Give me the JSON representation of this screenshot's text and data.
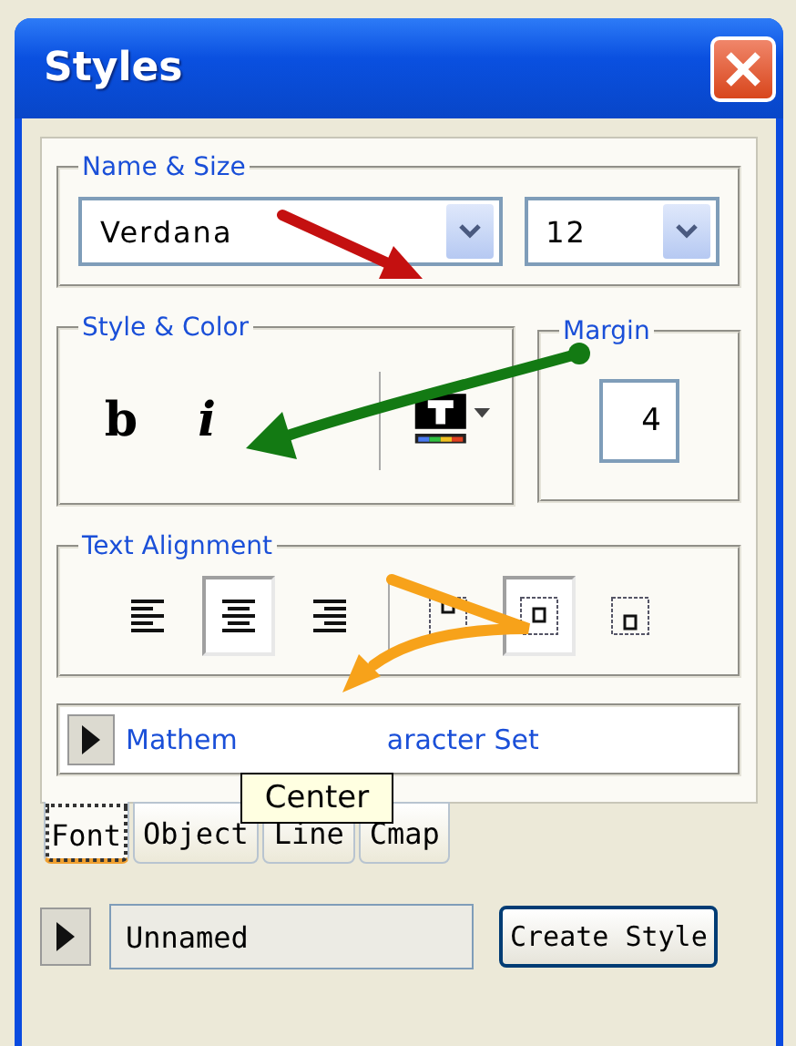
{
  "window": {
    "title": "Styles"
  },
  "name_size": {
    "legend": "Name & Size",
    "font": "Verdana",
    "size": "12"
  },
  "style_color": {
    "legend": "Style & Color",
    "bold": "b",
    "italic": "i"
  },
  "margin": {
    "legend": "Margin",
    "value": "4"
  },
  "text_alignment": {
    "legend": "Text Alignment",
    "buttons": [
      {
        "kind": "left",
        "selected": false
      },
      {
        "kind": "center",
        "selected": true
      },
      {
        "kind": "right",
        "selected": false
      },
      {
        "kind": "top",
        "selected": false
      },
      {
        "kind": "middle",
        "selected": true
      },
      {
        "kind": "bottom",
        "selected": false
      }
    ]
  },
  "character_set": {
    "text_before": "Mathem",
    "text_after": "aracter Set"
  },
  "tooltip": "Center",
  "tabs": [
    {
      "label": "Font",
      "selected": true
    },
    {
      "label": "Object",
      "selected": false
    },
    {
      "label": "Line",
      "selected": false
    },
    {
      "label": "Cmap",
      "selected": false
    }
  ],
  "style_name": {
    "value": "Unnamed"
  },
  "buttons": [
    "Create Style"
  ]
}
